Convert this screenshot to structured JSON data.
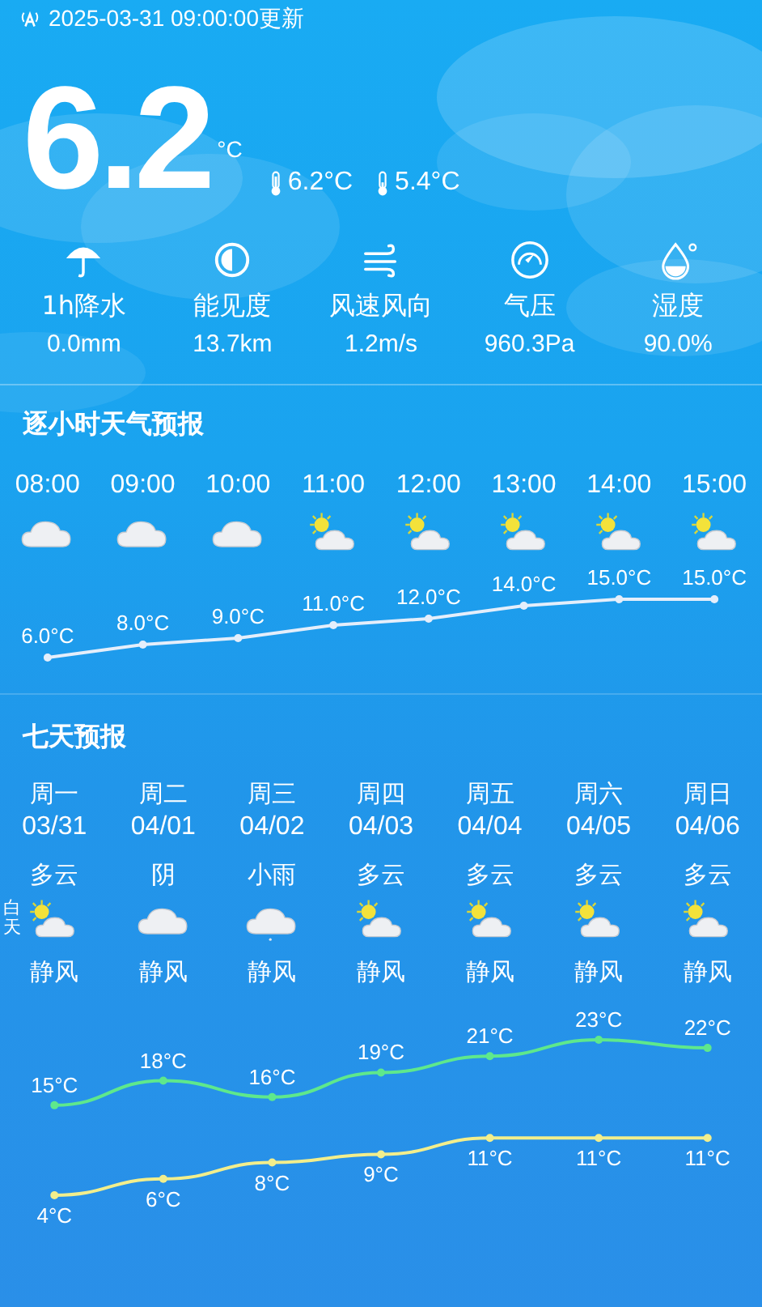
{
  "status": {
    "update_time": "2025-03-31 09:00:00更新"
  },
  "current": {
    "temperature": "6.2",
    "unit": "°C",
    "readings": [
      {
        "kind": "thermometer",
        "text": "6.2°C"
      },
      {
        "kind": "thermometer_low",
        "text": "5.4°C"
      }
    ]
  },
  "stats": [
    {
      "kind": "rain",
      "label": "1h降水",
      "value": "0.0mm"
    },
    {
      "kind": "visibility",
      "label": "能见度",
      "value": "13.7km"
    },
    {
      "kind": "wind",
      "label": "风速风向",
      "value": "1.2m/s"
    },
    {
      "kind": "pressure",
      "label": "气压",
      "value": "960.3Pa"
    },
    {
      "kind": "humidity",
      "label": "湿度",
      "value": "90.0%"
    }
  ],
  "hourly": {
    "title": "逐小时天气预报",
    "hours": [
      {
        "time": "08:00",
        "kind": "cloudy"
      },
      {
        "time": "09:00",
        "kind": "cloudy"
      },
      {
        "time": "10:00",
        "kind": "cloudy"
      },
      {
        "time": "11:00",
        "kind": "partly_cloudy"
      },
      {
        "time": "12:00",
        "kind": "partly_cloudy"
      },
      {
        "time": "13:00",
        "kind": "partly_cloudy"
      },
      {
        "time": "14:00",
        "kind": "partly_cloudy"
      },
      {
        "time": "15:00",
        "kind": "partly_cloudy"
      }
    ],
    "chart_data": {
      "type": "line",
      "categories": [
        null,
        null,
        null,
        null,
        null,
        null,
        null,
        null
      ],
      "series": [
        {
          "marker": true,
          "color": "#e4eefb",
          "values": [
            6,
            8,
            9,
            11,
            12,
            14,
            15,
            15
          ],
          "value_labels": [
            "6.0°C",
            "8.0°C",
            "9.0°C",
            "11.0°C",
            "12.0°C",
            "14.0°C",
            "15.0°C",
            "15.0°C"
          ]
        }
      ]
    }
  },
  "daily": {
    "title": "七天预报",
    "days": [
      {
        "weekday": "周一",
        "date": "03/31",
        "condition": "多云",
        "kind": "partly_cloudy",
        "period": "白天",
        "wind": "静风"
      },
      {
        "weekday": "周二",
        "date": "04/01",
        "condition": "阴",
        "kind": "cloudy",
        "wind": "静风"
      },
      {
        "weekday": "周三",
        "date": "04/02",
        "condition": "小雨",
        "kind": "rain",
        "wind": "静风"
      },
      {
        "weekday": "周四",
        "date": "04/03",
        "condition": "多云",
        "kind": "partly_cloudy",
        "wind": "静风"
      },
      {
        "weekday": "周五",
        "date": "04/04",
        "condition": "多云",
        "kind": "partly_cloudy",
        "wind": "静风"
      },
      {
        "weekday": "周六",
        "date": "04/05",
        "condition": "多云",
        "kind": "partly_cloudy",
        "wind": "静风"
      },
      {
        "weekday": "周日",
        "date": "04/06",
        "condition": "多云",
        "kind": "partly_cloudy",
        "wind": "静风"
      }
    ],
    "chart_data": {
      "type": "line",
      "series": [
        {
          "marker": true,
          "color": "#5ee88c",
          "values": [
            15,
            18,
            16,
            19,
            21,
            23,
            22
          ],
          "value_labels": [
            "15°C",
            "18°C",
            "16°C",
            "19°C",
            "21°C",
            "23°C",
            "22°C"
          ]
        },
        {
          "marker": true,
          "color": "#f2ee8c",
          "values": [
            4,
            6,
            8,
            9,
            11,
            11,
            11
          ],
          "value_labels": [
            "4°C",
            "6°C",
            "8°C",
            "9°C",
            "11°C",
            "11°C",
            "11°C"
          ]
        }
      ]
    }
  }
}
